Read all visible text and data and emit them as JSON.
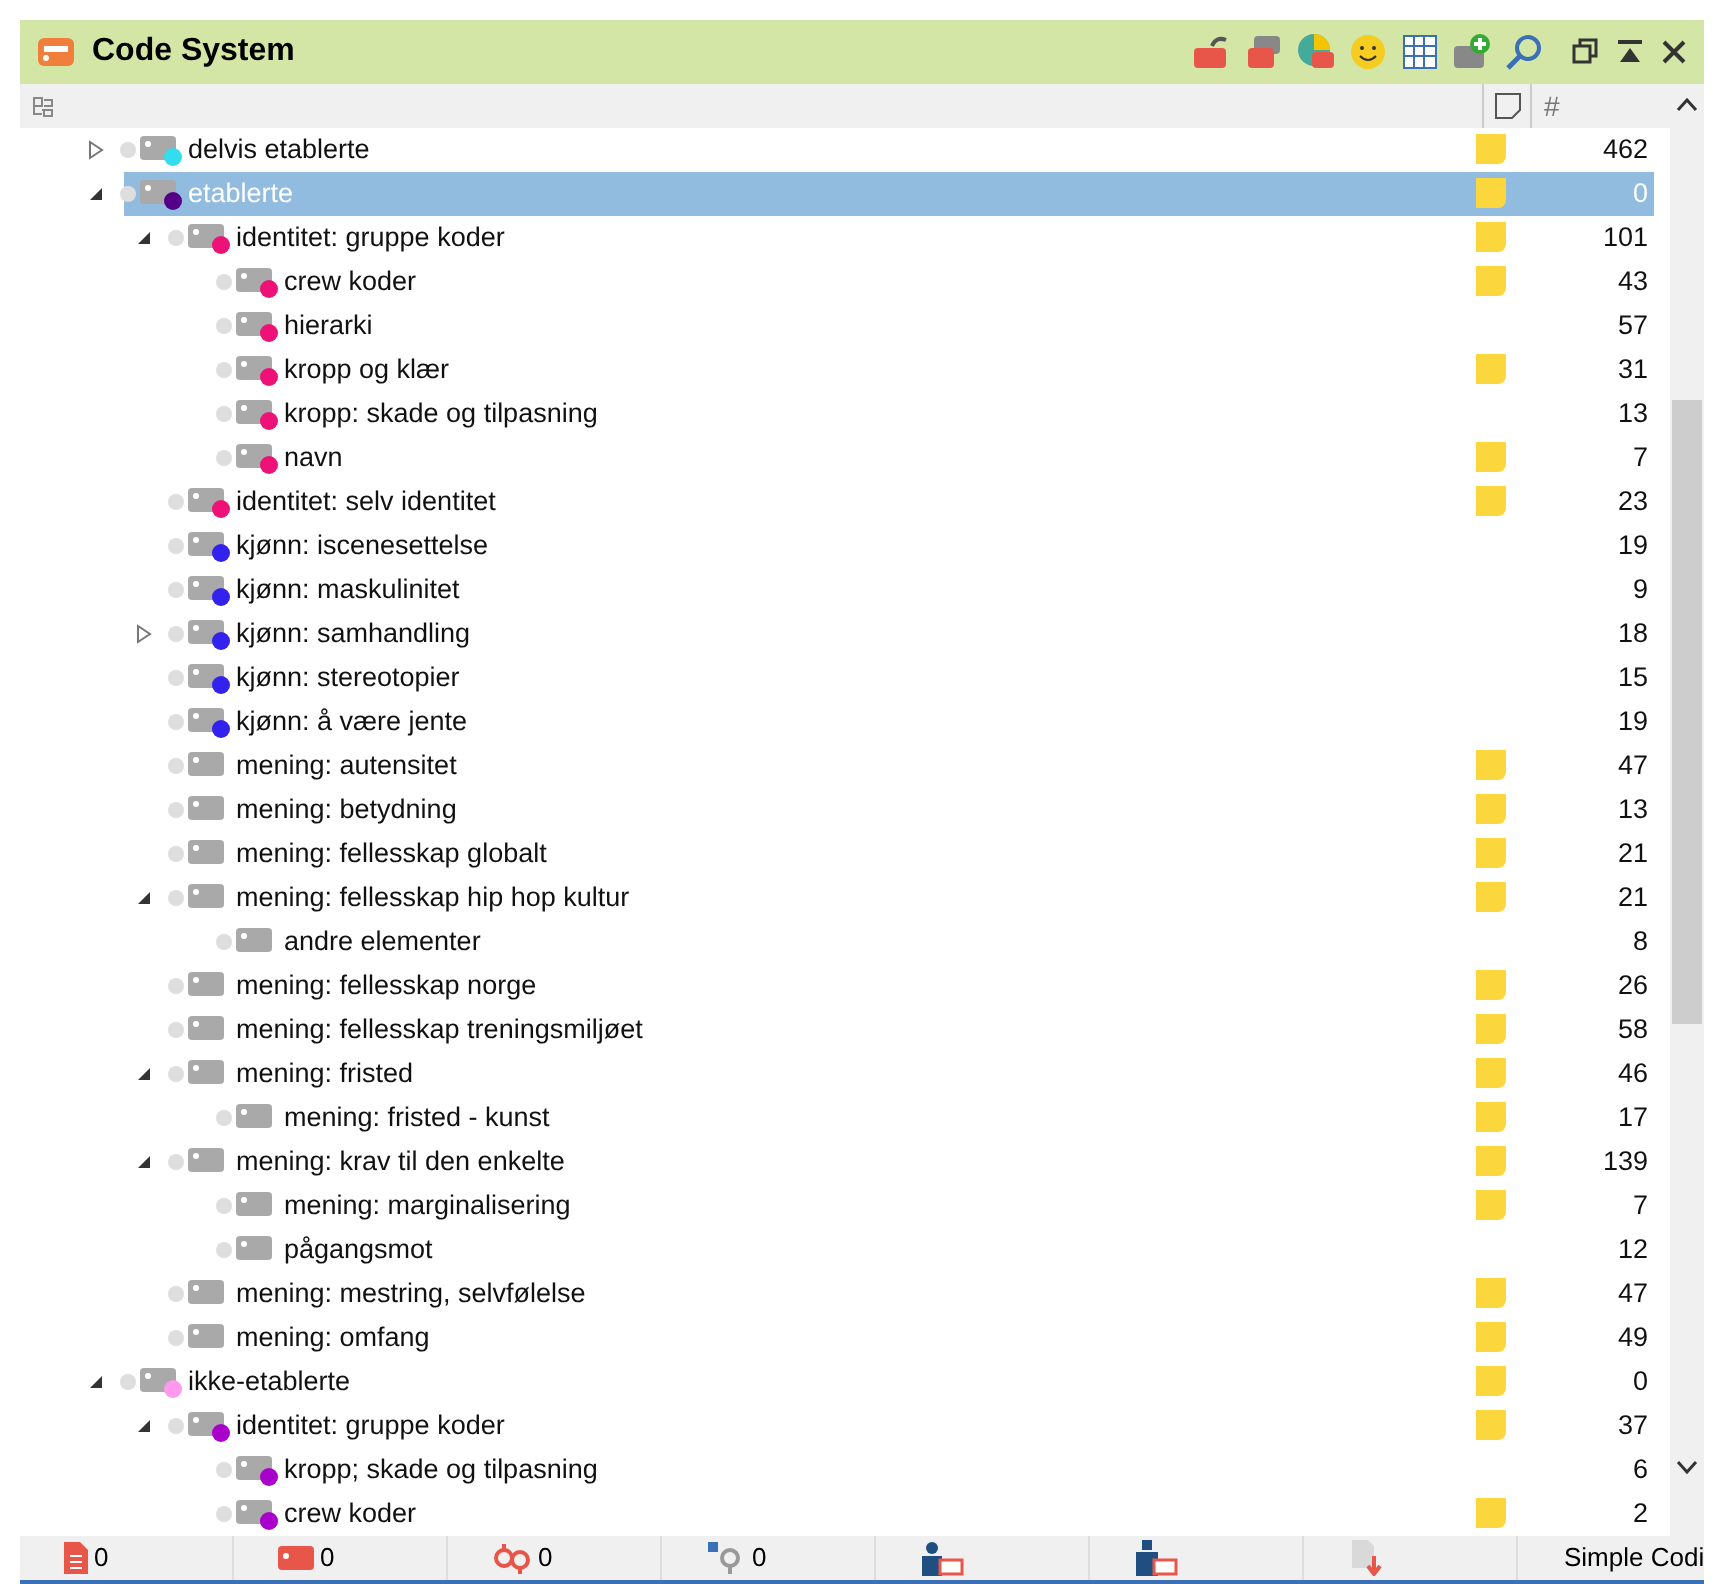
{
  "window": {
    "title": "Code System"
  },
  "columns": {
    "count_header": "#"
  },
  "tree": [
    {
      "label": "delvis etablerte",
      "count": "462",
      "memo": true,
      "color": "#33ddee",
      "selected": false,
      "expanded": false
    },
    {
      "label": "etablerte",
      "count": "0",
      "memo": true,
      "color": "#550088",
      "selected": true,
      "expanded": true,
      "children": [
        {
          "label": "identitet: gruppe koder",
          "count": "101",
          "memo": true,
          "color": "#ee1177",
          "selected": false,
          "expanded": true,
          "children": [
            {
              "label": "crew koder",
              "count": "43",
              "memo": true,
              "color": "#ee1177",
              "selected": false
            },
            {
              "label": "hierarki",
              "count": "57",
              "memo": false,
              "color": "#ee1177",
              "selected": false
            },
            {
              "label": "kropp og klær",
              "count": "31",
              "memo": true,
              "color": "#ee1177",
              "selected": false
            },
            {
              "label": "kropp: skade og tilpasning",
              "count": "13",
              "memo": false,
              "color": "#ee1177",
              "selected": false
            },
            {
              "label": "navn",
              "count": "7",
              "memo": true,
              "color": "#ee1177",
              "selected": false
            }
          ]
        },
        {
          "label": "identitet: selv identitet",
          "count": "23",
          "memo": true,
          "color": "#ee1177",
          "selected": false
        },
        {
          "label": "kjønn: iscenesettelse",
          "count": "19",
          "memo": false,
          "color": "#3322ee",
          "selected": false
        },
        {
          "label": "kjønn: maskulinitet",
          "count": "9",
          "memo": false,
          "color": "#3322ee",
          "selected": false
        },
        {
          "label": "kjønn: samhandling",
          "count": "18",
          "memo": false,
          "color": "#3322ee",
          "selected": false,
          "expanded": false
        },
        {
          "label": "kjønn: stereotopier",
          "count": "15",
          "memo": false,
          "color": "#3322ee",
          "selected": false
        },
        {
          "label": "kjønn: å være jente",
          "count": "19",
          "memo": false,
          "color": "#3322ee",
          "selected": false
        },
        {
          "label": "mening: autensitet",
          "count": "47",
          "memo": true,
          "selected": false
        },
        {
          "label": "mening: betydning",
          "count": "13",
          "memo": true,
          "selected": false
        },
        {
          "label": "mening: fellesskap globalt",
          "count": "21",
          "memo": true,
          "selected": false
        },
        {
          "label": "mening: fellesskap hip hop kultur",
          "count": "21",
          "memo": true,
          "selected": false,
          "expanded": true,
          "children": [
            {
              "label": "andre elementer",
              "count": "8",
              "memo": false,
              "selected": false
            }
          ]
        },
        {
          "label": "mening: fellesskap norge",
          "count": "26",
          "memo": true,
          "selected": false
        },
        {
          "label": "mening: fellesskap treningsmiljøet",
          "count": "58",
          "memo": true,
          "selected": false
        },
        {
          "label": "mening: fristed",
          "count": "46",
          "memo": true,
          "selected": false,
          "expanded": true,
          "children": [
            {
              "label": "mening: fristed - kunst",
              "count": "17",
              "memo": true,
              "selected": false
            }
          ]
        },
        {
          "label": "mening: krav til den enkelte",
          "count": "139",
          "memo": true,
          "selected": false,
          "expanded": true,
          "children": [
            {
              "label": "mening: marginalisering",
              "count": "7",
              "memo": true,
              "selected": false
            },
            {
              "label": "pågangsmot",
              "count": "12",
              "memo": false,
              "selected": false
            }
          ]
        },
        {
          "label": "mening: mestring, selvfølelse",
          "count": "47",
          "memo": true,
          "selected": false
        },
        {
          "label": "mening: omfang",
          "count": "49",
          "memo": true,
          "selected": false
        }
      ]
    },
    {
      "label": "ikke-etablerte",
      "count": "0",
      "memo": true,
      "color": "#ff99ee",
      "selected": false,
      "expanded": true,
      "children": [
        {
          "label": "identitet: gruppe koder",
          "count": "37",
          "memo": true,
          "color": "#aa00cc",
          "selected": false,
          "expanded": true,
          "children": [
            {
              "label": "kropp; skade og tilpasning",
              "count": "6",
              "memo": false,
              "color": "#aa00cc",
              "selected": false
            },
            {
              "label": "crew koder",
              "count": "2",
              "memo": true,
              "color": "#aa00cc",
              "selected": false
            }
          ]
        }
      ]
    }
  ],
  "status_bar": [
    {
      "kind": "document",
      "count": "0"
    },
    {
      "kind": "code",
      "count": "0"
    },
    {
      "kind": "link",
      "count": "0"
    },
    {
      "kind": "variable",
      "count": "0"
    },
    {
      "kind": "user"
    },
    {
      "kind": "user-set"
    },
    {
      "kind": "import"
    },
    {
      "kind": "mode",
      "label": "Simple Codi"
    }
  ]
}
